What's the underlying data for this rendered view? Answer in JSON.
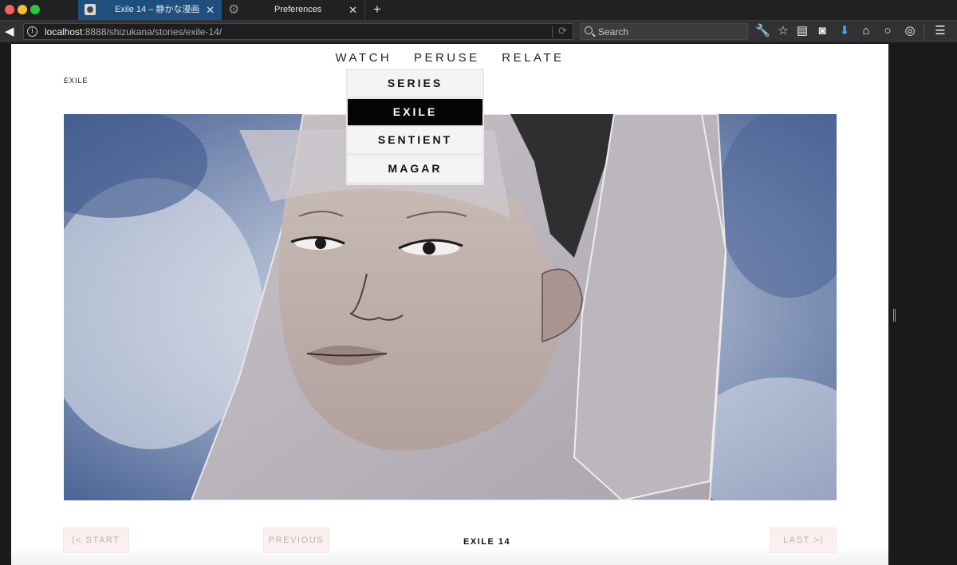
{
  "browser": {
    "tabs": [
      {
        "title": "Exile 14 – 静かな漫画",
        "active": true
      },
      {
        "title": "Preferences",
        "active": false
      }
    ],
    "url_host": "localhost",
    "url_rest": ":8888/shizukana/stories/exile-14/",
    "search_placeholder": "Search",
    "icons": [
      "back-icon",
      "info-icon",
      "reload-icon",
      "search-icon",
      "wrench-icon",
      "star-icon",
      "reading-list-icon",
      "pocket-icon",
      "download-icon",
      "home-icon",
      "chat-icon",
      "sync-icon",
      "hamburger-menu-icon"
    ]
  },
  "site": {
    "nav": [
      "WATCH",
      "PERUSE",
      "RELATE"
    ],
    "section_label": "EXILE",
    "dropdown": [
      {
        "label": "SERIES",
        "selected": false
      },
      {
        "label": "EXILE",
        "selected": true
      },
      {
        "label": "SENTIENT",
        "selected": false
      },
      {
        "label": "MAGAR",
        "selected": false
      }
    ],
    "pager": {
      "start": "|< START",
      "previous": "PREVIOUS",
      "current": "EXILE 14",
      "last": "LAST >|"
    }
  },
  "colors": {
    "accent_tab": "#1f4f7c",
    "selected_item": "#050505",
    "pager_button_bg": "#fbf0ef"
  }
}
